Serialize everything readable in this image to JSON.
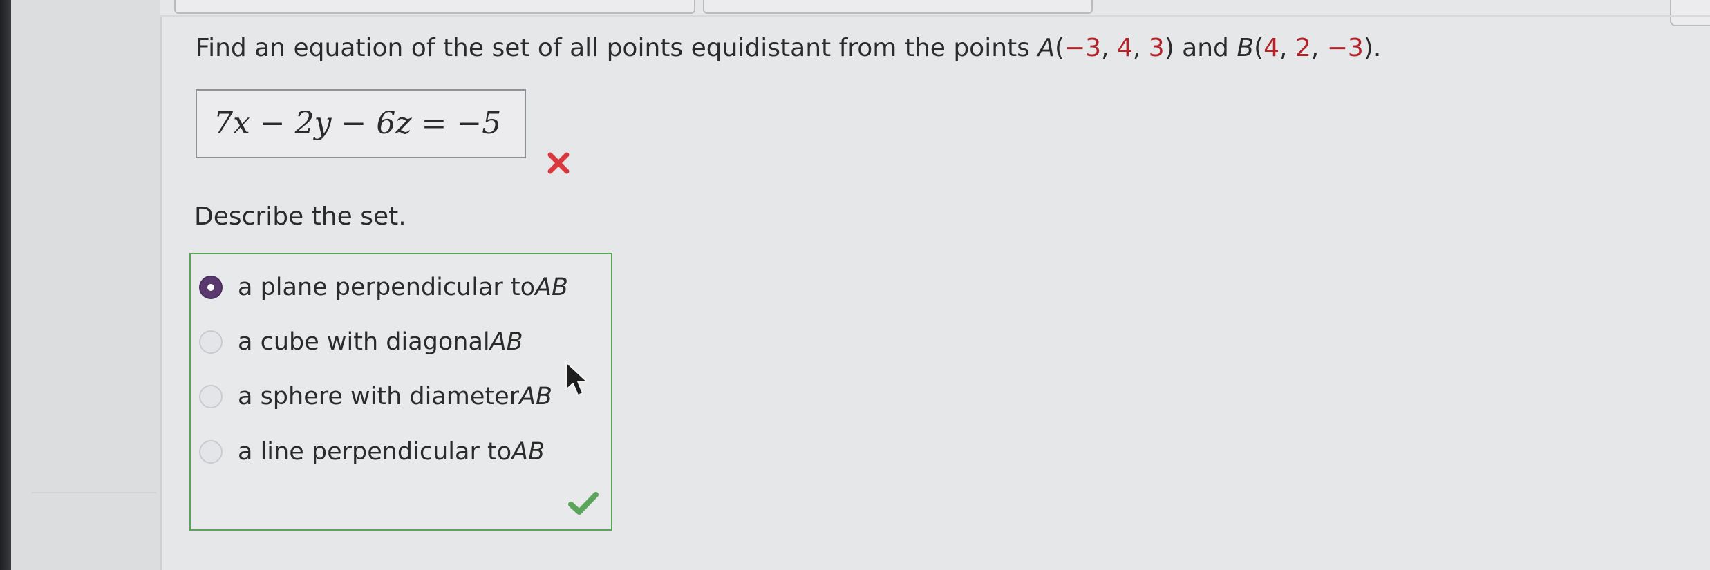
{
  "question": {
    "prefix": "Find an equation of the set of all points equidistant from the points ",
    "point_a_label": "A",
    "point_a_open": "(",
    "point_a_x": "−3",
    "point_a_y": "4",
    "point_a_z": "3",
    "point_a_close": ")",
    "connector": " and ",
    "point_b_label": "B",
    "point_b_open": "(",
    "point_b_x": "4",
    "point_b_y": "2",
    "point_b_z": "−3",
    "point_b_close": ").",
    "separator": ", "
  },
  "answer": {
    "equation": "7x − 2y − 6z = −5",
    "status_icon": "wrong-x-icon"
  },
  "describe_prompt": "Describe the set.",
  "options": [
    {
      "text": "a plane perpendicular to ",
      "ab": "AB",
      "selected": true
    },
    {
      "text": "a cube with diagonal ",
      "ab": "AB",
      "selected": false
    },
    {
      "text": "a sphere with diameter ",
      "ab": "AB",
      "selected": false
    },
    {
      "text": "a line perpendicular to ",
      "ab": "AB",
      "selected": false
    }
  ],
  "options_status_icon": "correct-check-icon",
  "colors": {
    "number_red": "#b2242a",
    "correct_green": "#5aa55a",
    "wrong_red": "#d9393e",
    "radio_selected": "#5a3a6e"
  }
}
